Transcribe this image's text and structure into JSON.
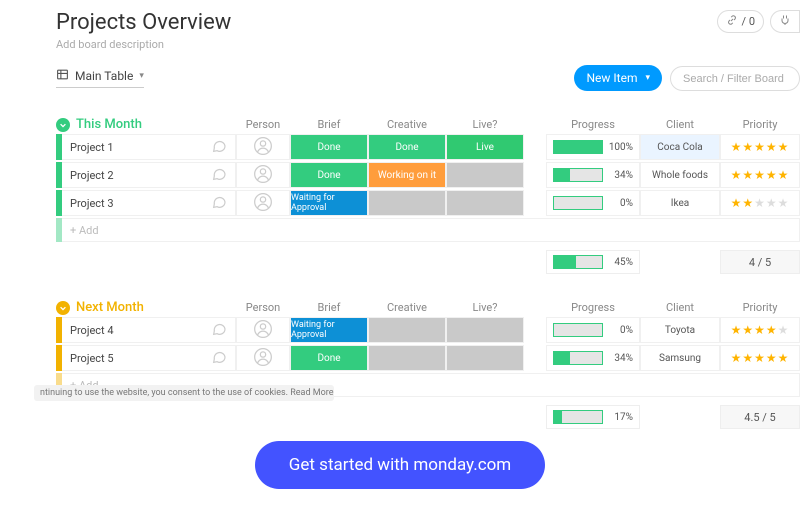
{
  "header": {
    "title": "Projects Overview",
    "subtitle": "Add board description",
    "activity_count": "/ 0",
    "view_name": "Main Table",
    "new_item_label": "New Item",
    "search_placeholder": "Search / Filter Board"
  },
  "columns": {
    "person": "Person",
    "brief": "Brief",
    "creative": "Creative",
    "live": "Live?",
    "progress": "Progress",
    "client": "Client",
    "priority": "Priority"
  },
  "groups": [
    {
      "name": "This Month",
      "color": "#33cc7f",
      "rows": [
        {
          "name": "Project 1",
          "brief": {
            "label": "Done",
            "class": "status-done"
          },
          "creative": {
            "label": "Done",
            "class": "status-done"
          },
          "live": {
            "label": "Live",
            "class": "status-live"
          },
          "progress": 100,
          "client": "Coca Cola",
          "client_highlight": true,
          "stars": 5
        },
        {
          "name": "Project 2",
          "brief": {
            "label": "Done",
            "class": "status-done"
          },
          "creative": {
            "label": "Working on it",
            "class": "status-work"
          },
          "live": {
            "label": "",
            "class": "status-empty"
          },
          "progress": 34,
          "client": "Whole foods",
          "client_highlight": false,
          "stars": 5
        },
        {
          "name": "Project 3",
          "brief": {
            "label": "Waiting for Approval",
            "class": "status-wait"
          },
          "creative": {
            "label": "",
            "class": "status-empty"
          },
          "live": {
            "label": "",
            "class": "status-empty"
          },
          "progress": 0,
          "client": "Ikea",
          "client_highlight": false,
          "stars": 2
        }
      ],
      "add_label": "+ Add",
      "summary_progress": 45,
      "summary_priority": "4 / 5"
    },
    {
      "name": "Next Month",
      "color": "#f2b200",
      "rows": [
        {
          "name": "Project 4",
          "brief": {
            "label": "Waiting for Approval",
            "class": "status-wait"
          },
          "creative": {
            "label": "",
            "class": "status-empty"
          },
          "live": {
            "label": "",
            "class": "status-empty"
          },
          "progress": 0,
          "client": "Toyota",
          "client_highlight": false,
          "stars": 4
        },
        {
          "name": "Project 5",
          "brief": {
            "label": "Done",
            "class": "status-done"
          },
          "creative": {
            "label": "",
            "class": "status-empty"
          },
          "live": {
            "label": "",
            "class": "status-empty"
          },
          "progress": 34,
          "client": "Samsung",
          "client_highlight": false,
          "stars": 5
        }
      ],
      "add_label": "+ Add",
      "summary_progress": 17,
      "summary_priority": "4.5 / 5"
    }
  ],
  "cta_label": "Get started with monday.com",
  "cookie_text": "ntinuing to use the website, you consent to the use of cookies. Read More"
}
